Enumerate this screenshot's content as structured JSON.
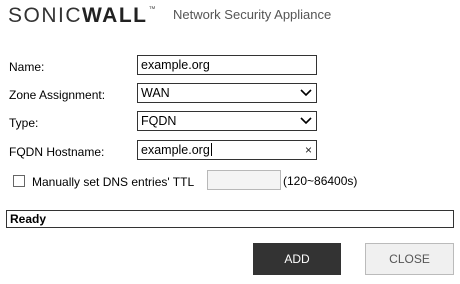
{
  "header": {
    "logo_text_light": "SONIC",
    "logo_text_bold": "WALL",
    "logo_tm": "™",
    "product_name": "Network Security Appliance"
  },
  "form": {
    "name": {
      "label": "Name:",
      "value": "example.org"
    },
    "zone": {
      "label": "Zone Assignment:",
      "value": "WAN"
    },
    "type": {
      "label": "Type:",
      "value": "FQDN"
    },
    "fqdn": {
      "label": "FQDN Hostname:",
      "value": "example.org",
      "clear_glyph": "×"
    },
    "ttl": {
      "checkbox_label": "Manually set DNS entries' TTL",
      "checked": false,
      "value": "",
      "range_text": "(120~86400s)"
    }
  },
  "status": {
    "text": "Ready"
  },
  "buttons": {
    "add": "ADD",
    "close": "CLOSE"
  },
  "colors": {
    "primary_button": "#333333",
    "secondary_button": "#f0f0f0",
    "field_border": "#333333"
  },
  "icons": {
    "dropdown": "chevron-down-icon",
    "clear": "clear-icon"
  }
}
